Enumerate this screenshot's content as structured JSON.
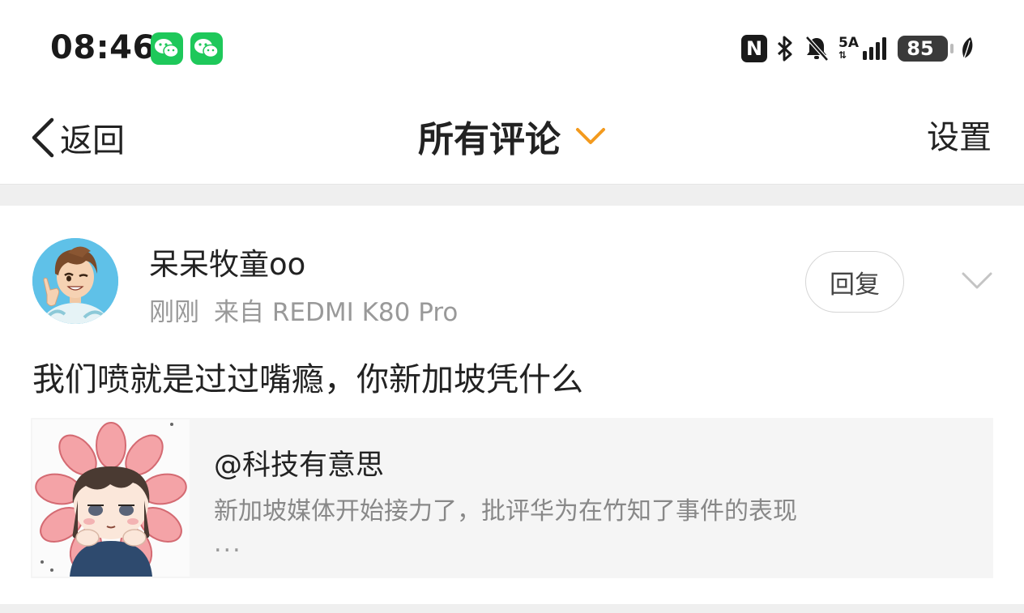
{
  "status_bar": {
    "time": "08:46",
    "nfc_label": "N",
    "network_label": "5A",
    "battery_level": "85"
  },
  "nav": {
    "back_label": "返回",
    "title": "所有评论",
    "settings_label": "设置",
    "accent_color": "#f39a1e"
  },
  "comment": {
    "username": "呆呆牧童oo",
    "time": "刚刚",
    "source": "来自 REDMI K80 Pro",
    "reply_label": "回复",
    "text": "我们喷就是过过嘴瘾，你新加坡凭什么",
    "quote": {
      "author": "@科技有意思",
      "text": "新加坡媒体开始接力了，批评华为在竹知了事件的表现",
      "ellipsis": "..."
    }
  }
}
